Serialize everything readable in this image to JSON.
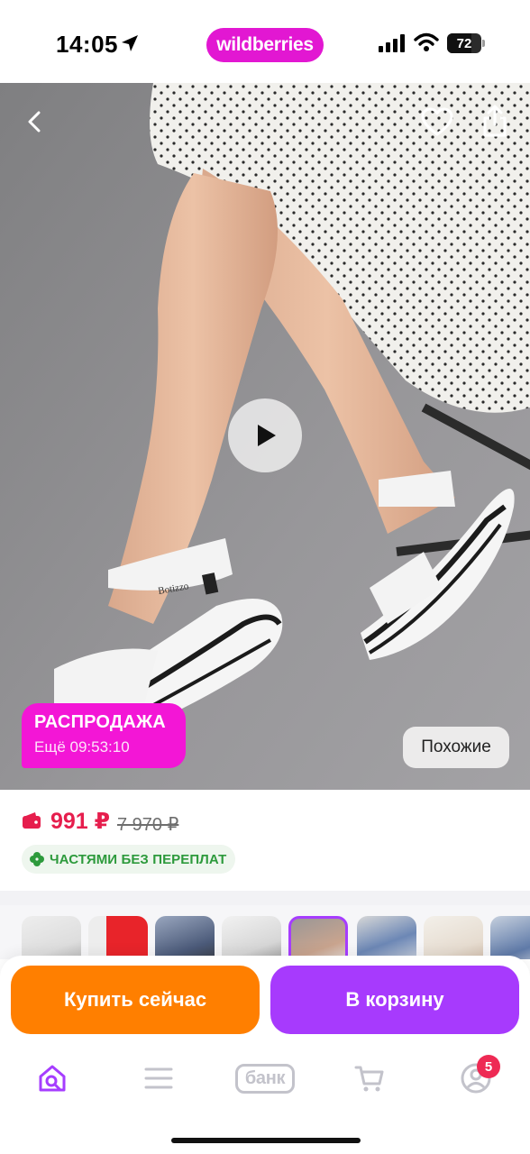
{
  "status_bar": {
    "time": "14:05",
    "brand": "wildberries",
    "battery_level": "72",
    "icons": [
      "location-arrow-icon",
      "signal-icon",
      "wifi-icon",
      "battery-icon"
    ]
  },
  "product_image": {
    "top_actions": [
      "back-icon",
      "heart-icon",
      "share-icon"
    ],
    "play_icon": "play-icon",
    "sale_badge": {
      "title": "РАСПРОДАЖА",
      "timer": "Ещё 09:53:10"
    },
    "similar_button": "Похожие",
    "shoe_brand_text": "Botizzo"
  },
  "price": {
    "current": "991 ₽",
    "old": "7 970 ₽",
    "installment": "ЧАСТЯМИ БЕЗ ПЕРЕПЛАТ"
  },
  "thumbnails": {
    "count_visible": 8,
    "active_index": 4
  },
  "actions": {
    "buy_now": "Купить сейчас",
    "add_to_cart": "В корзину"
  },
  "tab_bar": {
    "items": [
      "home-search-icon",
      "menu-icon",
      "bank",
      "cart-icon",
      "profile-icon"
    ],
    "bank_label": "банк",
    "profile_badge": "5"
  },
  "colors": {
    "brand_pink": "#e217d2",
    "sale_pink": "#f316d6",
    "price_red": "#e61e4d",
    "buy_orange": "#ff7f00",
    "cart_purple": "#a73afd",
    "installment_green": "#2d9a3c",
    "badge_red": "#ee2a54"
  }
}
